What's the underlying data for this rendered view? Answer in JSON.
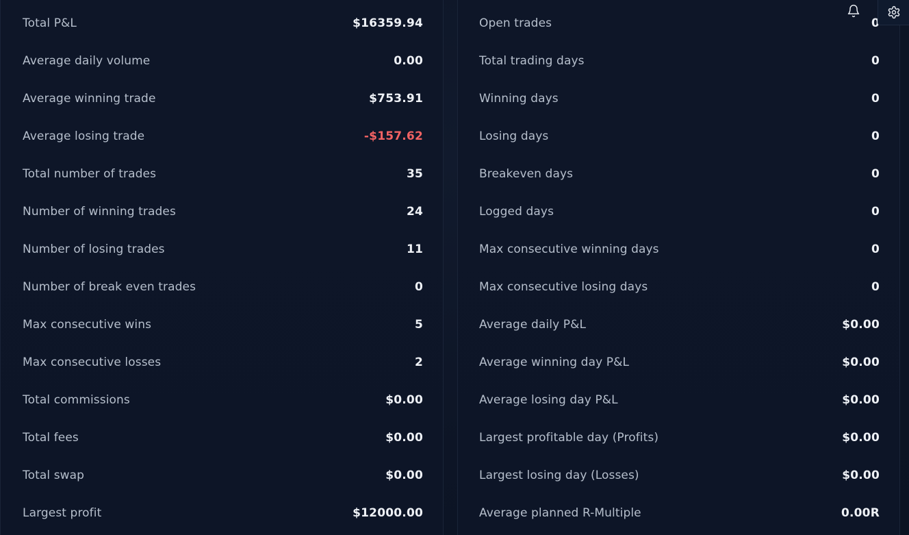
{
  "left_stats": [
    {
      "label": "Total P&L",
      "value": "$16359.94"
    },
    {
      "label": "Average daily volume",
      "value": "0.00"
    },
    {
      "label": "Average winning trade",
      "value": "$753.91"
    },
    {
      "label": "Average losing trade",
      "value": "-$157.62",
      "negative": true
    },
    {
      "label": "Total number of trades",
      "value": "35"
    },
    {
      "label": "Number of winning trades",
      "value": "24"
    },
    {
      "label": "Number of losing trades",
      "value": "11"
    },
    {
      "label": "Number of break even trades",
      "value": "0"
    },
    {
      "label": "Max consecutive wins",
      "value": "5"
    },
    {
      "label": "Max consecutive losses",
      "value": "2"
    },
    {
      "label": "Total commissions",
      "value": "$0.00"
    },
    {
      "label": "Total fees",
      "value": "$0.00"
    },
    {
      "label": "Total swap",
      "value": "$0.00"
    },
    {
      "label": "Largest profit",
      "value": "$12000.00"
    }
  ],
  "right_stats": [
    {
      "label": "Open trades",
      "value": "0"
    },
    {
      "label": "Total trading days",
      "value": "0"
    },
    {
      "label": "Winning days",
      "value": "0"
    },
    {
      "label": "Losing days",
      "value": "0"
    },
    {
      "label": "Breakeven days",
      "value": "0"
    },
    {
      "label": "Logged days",
      "value": "0"
    },
    {
      "label": "Max consecutive winning days",
      "value": "0"
    },
    {
      "label": "Max consecutive losing days",
      "value": "0"
    },
    {
      "label": "Average daily P&L",
      "value": "$0.00"
    },
    {
      "label": "Average winning day P&L",
      "value": "$0.00"
    },
    {
      "label": "Average losing day P&L",
      "value": "$0.00"
    },
    {
      "label": "Largest profitable day (Profits)",
      "value": "$0.00"
    },
    {
      "label": "Largest losing day (Losses)",
      "value": "$0.00"
    },
    {
      "label": "Average planned R-Multiple",
      "value": "0.00R"
    }
  ],
  "toolbar": {
    "bell_icon": "bell-icon",
    "gear_icon": "gear-icon"
  },
  "colors": {
    "background": "#0d1526",
    "label": "#b6bfcc",
    "value": "#eef1f6",
    "negative": "#f26363"
  }
}
